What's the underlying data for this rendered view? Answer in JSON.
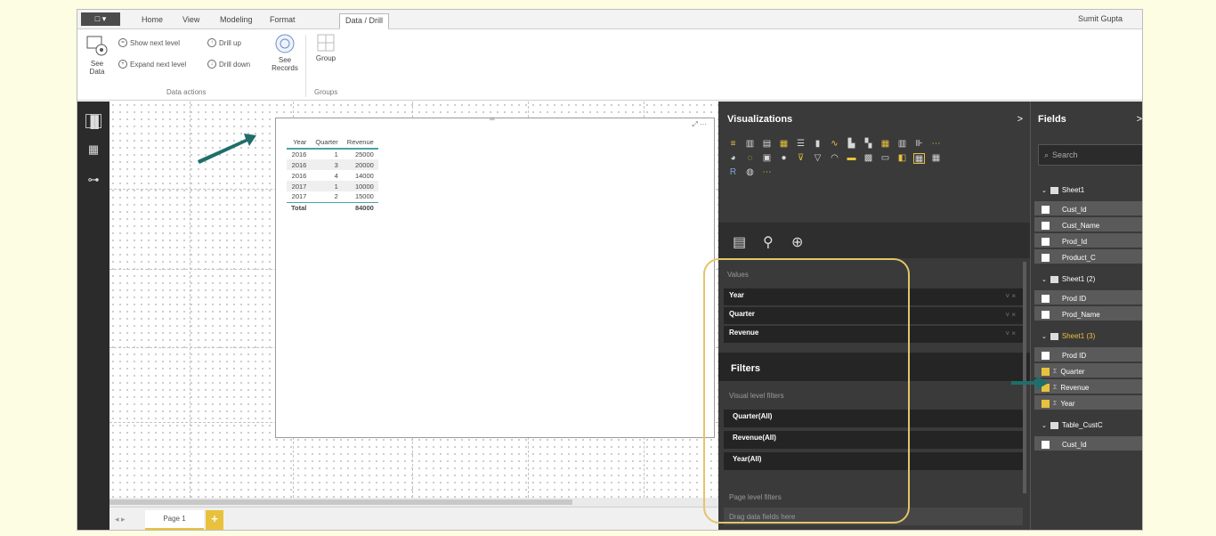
{
  "ribbon": {
    "file_label": "□ ▾",
    "tabs": [
      "Home",
      "View",
      "Modeling",
      "Format",
      "Data / Drill"
    ],
    "user": "Sumit Gupta",
    "see_data": "See\nData",
    "show_next_level": "Show next level",
    "expand_next_level": "Expand next level",
    "drill_up": "Drill up",
    "drill_down": "Drill down",
    "see_records": "See\nRecords",
    "group": "Group",
    "group_data_actions": "Data actions",
    "group_groups": "Groups"
  },
  "table": {
    "headers": [
      "Year",
      "Quarter",
      "Revenue"
    ],
    "rows": [
      [
        "2016",
        "1",
        "25000"
      ],
      [
        "2016",
        "3",
        "20000"
      ],
      [
        "2016",
        "4",
        "14000"
      ],
      [
        "2017",
        "1",
        "10000"
      ],
      [
        "2017",
        "2",
        "15000"
      ]
    ],
    "total_label": "Total",
    "total_value": "84000"
  },
  "pages": {
    "page1": "Page 1",
    "add": "+"
  },
  "viz": {
    "title": "Visualizations",
    "chevron": ">",
    "values_label": "Values",
    "fields": [
      "Year",
      "Quarter",
      "Revenue"
    ],
    "well_x": "˅ ×",
    "filters_title": "Filters",
    "visual_level": "Visual level filters",
    "filters": [
      "Quarter(All)",
      "Revenue(All)",
      "Year(All)"
    ],
    "page_level": "Page level filters",
    "drag_here": "Drag data fields here",
    "more": "···"
  },
  "fields": {
    "title": "Fields",
    "chevron": ">",
    "search_placeholder": "Search",
    "search_icon": "search-icon",
    "tables": [
      {
        "name": "Sheet1",
        "items": [
          "Cust_Id",
          "Cust_Name",
          "Prod_Id",
          "Product_C"
        ]
      },
      {
        "name": "Sheet1 (2)",
        "items": [
          "Prod ID",
          "Prod_Name"
        ]
      },
      {
        "name": "Sheet1 (3)",
        "items": [
          "Prod ID",
          "Quarter",
          "Revenue",
          "Year"
        ]
      },
      {
        "name": "Table_CustC",
        "items": [
          "Cust_Id"
        ]
      }
    ]
  },
  "colors": {
    "accent": "#e8c23c",
    "teal": "#1f6e6a",
    "oval": "#e3c46a"
  }
}
